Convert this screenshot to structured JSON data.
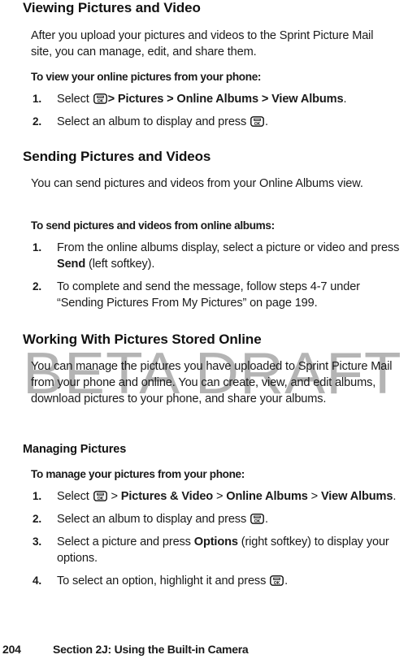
{
  "page": {
    "background_color": "#ffffff",
    "text_color": "#1a1a1a",
    "watermark": {
      "text": "BETA DRAFT",
      "color": "#b4b4b4"
    }
  },
  "sections": [
    {
      "heading": "Viewing Pictures and Video",
      "paragraph": "After you upload your pictures and videos to the Sprint Picture Mail site, you can manage, edit, and share them.",
      "lead_in": "To view your online pictures from your phone:",
      "steps": [
        {
          "number": "1.",
          "pre": "Select ",
          "icon": "ok-key-icon",
          "chain_sep_bold": true,
          "post_plain": " ",
          "bold_chain": "> Pictures > Online Albums > View Albums",
          "tail": "."
        },
        {
          "number": "2.",
          "pre": "Select an album to display and press ",
          "icon": "ok-key-icon",
          "tail": "."
        }
      ]
    },
    {
      "heading": "Sending Pictures and Videos",
      "paragraph": "You can send pictures and videos from your Online Albums view.",
      "lead_in": "To send pictures and videos from online albums:",
      "steps": [
        {
          "number": "1.",
          "pre": "From the online albums display, select a picture or video and press ",
          "bold_word": "Send",
          "tail": " (left softkey)."
        },
        {
          "number": "2.",
          "pre": "To complete and send the message, follow steps 4-7 under “Sending Pictures From My Pictures” on page 199."
        }
      ]
    },
    {
      "heading": "Working With Pictures Stored Online",
      "paragraph": "You can manage the pictures you have uploaded to Sprint Picture Mail from your phone and online. You can create, view, and edit albums, download pictures to your phone, and share your albums.",
      "subheading": "Managing Pictures",
      "lead_in": "To manage your pictures from your phone:",
      "steps": [
        {
          "number": "1.",
          "pre": "Select ",
          "icon": "ok-key-icon",
          "sep1": " > ",
          "b1": "Pictures & Video",
          "sep2": " > ",
          "b2": "Online Albums",
          "sep3": " > ",
          "b3": "View Albums",
          "tail": "."
        },
        {
          "number": "2.",
          "pre": "Select an album to display and press ",
          "icon": "ok-key-icon",
          "tail": "."
        },
        {
          "number": "3.",
          "pre": "Select a picture and press ",
          "bold_word": "Options",
          "tail": " (right softkey) to display your options."
        },
        {
          "number": "4.",
          "pre": "To select an option, highlight it and press ",
          "icon": "ok-key-icon",
          "tail": "."
        }
      ]
    }
  ],
  "footer": {
    "page_number": "204",
    "section_label": "Section 2J: Using the Built-in Camera"
  }
}
